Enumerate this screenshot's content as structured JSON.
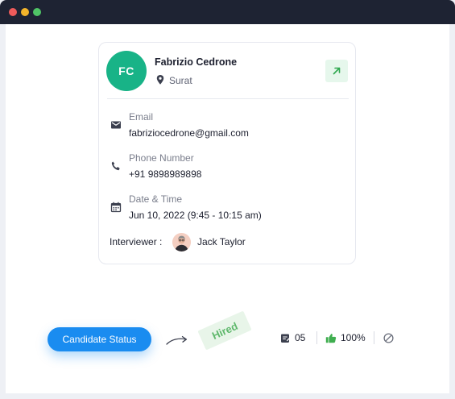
{
  "candidate": {
    "initials": "FC",
    "name": "Fabrizio Cedrone",
    "location": "Surat",
    "email_label": "Email",
    "email": "fabriziocedrone@gmail.com",
    "phone_label": "Phone Number",
    "phone": "+91 9898989898",
    "datetime_label": "Date & Time",
    "datetime": "Jun 10, 2022 (9:45 - 10:15 am)",
    "interviewer_label": "Interviewer :",
    "interviewer_name": "Jack Taylor"
  },
  "footer": {
    "status_button": "Candidate Status",
    "status_stamp": "Hired",
    "notes_count": "05",
    "approval": "100%"
  },
  "colors": {
    "avatar": "#18b387",
    "primary": "#1a8cf0",
    "success": "#5fb86c"
  },
  "icons": [
    "pin-icon",
    "external-link-icon",
    "mail-icon",
    "phone-icon",
    "calendar-icon",
    "notes-icon",
    "thumbs-up-icon",
    "block-icon",
    "curved-arrow-icon"
  ]
}
